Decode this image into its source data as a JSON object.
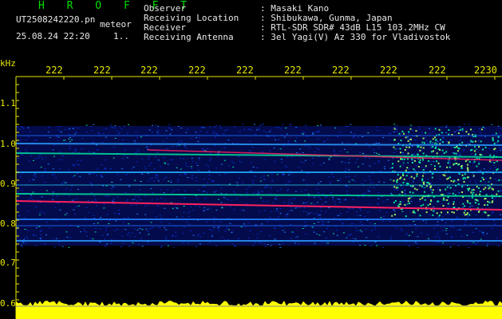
{
  "header": {
    "brand": "H R O F F T",
    "filename": "UT2508242220.pn",
    "filename_tag": "meteor",
    "datetime": "25.08.24 22:20",
    "datetime_extra": "1..",
    "fields": [
      {
        "key": "Observer",
        "value": ": Masaki Kano"
      },
      {
        "key": "Receiving Location",
        "value": ": Shibukawa, Gunma, Japan"
      },
      {
        "key": "Receiver",
        "value": ": RTL-SDR SDR# 43dB L15 103.2MHz CW"
      },
      {
        "key": "Receiving Antenna",
        "value": ": 3el Yagi(V) Az 330 for Vladivostok"
      }
    ]
  },
  "plot": {
    "unit_label": "kHz",
    "time_ticks": [
      "222",
      "222",
      "222",
      "222",
      "222",
      "222",
      "222",
      "222",
      "222",
      "2230"
    ],
    "freq_ticks": [
      "1.1",
      "1.0",
      "0.9",
      "0.8",
      "0.7",
      "0.6"
    ],
    "colors": {
      "background": "#000000",
      "noise": "#0a2cc8",
      "signal": "#00e0a0",
      "echo": "#ff2060",
      "level": "#ffff00",
      "axis": "#e8e800"
    }
  }
}
